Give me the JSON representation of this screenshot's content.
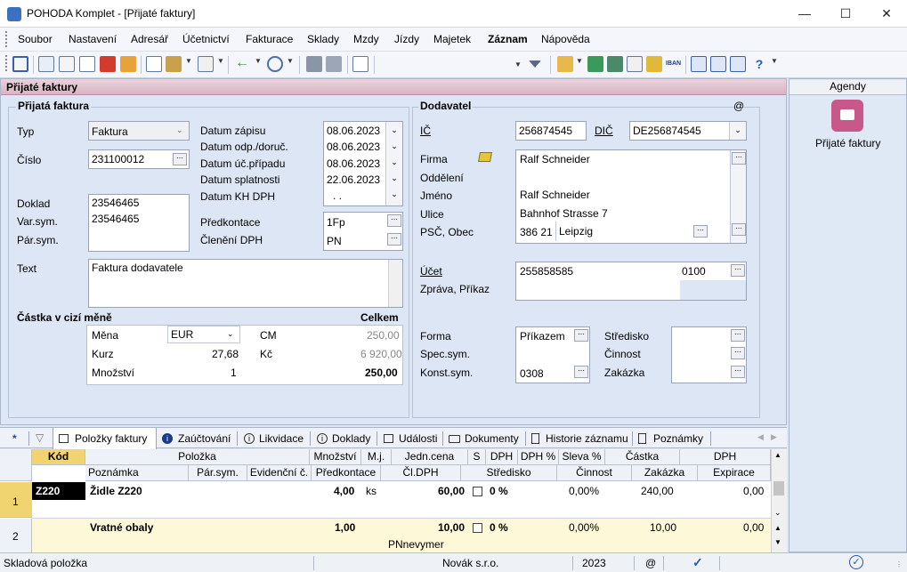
{
  "window": {
    "title": "POHODA Komplet - [Přijaté faktury]"
  },
  "menu": [
    "Soubor",
    "Nastavení",
    "Adresář",
    "Účetnictví",
    "Fakturace",
    "Sklady",
    "Mzdy",
    "Jízdy",
    "Majetek",
    "Záznam",
    "Nápověda"
  ],
  "toolbar": {
    "search_value": "",
    "iban_label": "IBAN"
  },
  "agenda_header": "Přijaté faktury",
  "left": {
    "group_title": "Přijatá faktura",
    "typ_label": "Typ",
    "typ_value": "Faktura",
    "cislo_label": "Číslo",
    "cislo_value": "231100012",
    "doklad_label": "Doklad",
    "doklad_value": "23546465",
    "varsym_label": "Var.sym.",
    "varsym_value": "23546465",
    "parsym_label": "Pár.sym.",
    "datum_zapisu_label": "Datum zápisu",
    "datum_zapisu": "08.06.2023",
    "datum_odp_label": "Datum odp./doruč.",
    "datum_odp": "08.06.2023",
    "datum_uc_label": "Datum úč.případu",
    "datum_uc": "08.06.2023",
    "datum_spl_label": "Datum splatnosti",
    "datum_spl": "22.06.2023",
    "datum_kh_label": "Datum KH DPH",
    "datum_kh": ". .",
    "predkontace_label": "Předkontace",
    "predkontace": "1Fp",
    "cleneni_label": "Členění DPH",
    "cleneni": "PN",
    "text_label": "Text",
    "text_value": "Faktura dodavatele",
    "cizi_title": "Částka v cizí měně",
    "celkem": "Celkem",
    "mena_label": "Měna",
    "mena": "EUR",
    "kurz_label": "Kurz",
    "kurz": "27,68",
    "mnozstvi_label": "Množství",
    "mnozstvi": "1",
    "cm_label": "CM",
    "cm_value": "250,00",
    "kc_label": "Kč",
    "kc_value": "6 920,00",
    "total": "250,00"
  },
  "right": {
    "group_title": "Dodavatel",
    "at": "@",
    "ic_label": "IČ",
    "ic": "256874545",
    "dic_label": "DIČ",
    "dic": "DE256874545",
    "firma_label": "Firma",
    "firma": "Ralf Schneider",
    "oddeleni_label": "Oddělení",
    "jmeno_label": "Jméno",
    "jmeno": "Ralf Schneider",
    "ulice_label": "Ulice",
    "ulice": "Bahnhof Strasse 7",
    "psc_label": "PSČ, Obec",
    "psc": "386 21",
    "obec": "Leipzig",
    "ucet_label": "Účet",
    "ucet": "255858585",
    "kod_banky": "0100",
    "zprava_label": "Zpráva, Příkaz",
    "forma_label": "Forma",
    "forma": "Příkazem",
    "spec_label": "Spec.sym.",
    "konst_label": "Konst.sym.",
    "konst": "0308",
    "stredisko_label": "Středisko",
    "cinnost_label": "Činnost",
    "zakazka_label": "Zakázka"
  },
  "sidebar": {
    "title": "Agendy",
    "item": "Přijaté faktury",
    "accent": "#c8588a"
  },
  "tabs": [
    "*",
    "Položky faktury",
    "Zaúčtování",
    "Likvidace",
    "Doklady",
    "Události",
    "Dokumenty",
    "Historie záznamu",
    "Poznámky"
  ],
  "grid": {
    "h1": [
      "Kód",
      "Položka",
      "Množství",
      "M.j.",
      "Jedn.cena",
      "S",
      "DPH",
      "DPH %",
      "Sleva %",
      "Částka",
      "DPH"
    ],
    "h2": [
      "Poznámka",
      "Pár.sym.",
      "Evidenční č.",
      "Předkontace",
      "Čl.DPH",
      "Středisko",
      "Činnost",
      "Zakázka",
      "Expirace"
    ],
    "rows": [
      {
        "num": "1",
        "kod": "Z220",
        "polozka": "Židle Z220",
        "mnozstvi": "4,00",
        "mj": "ks",
        "cena": "60,00",
        "dph_pct": "0 %",
        "sleva": "0,00%",
        "castka": "240,00",
        "dph": "0,00",
        "sub": ""
      },
      {
        "num": "2",
        "kod": "",
        "polozka": "Vratné obaly",
        "mnozstvi": "1,00",
        "mj": "",
        "cena": "10,00",
        "dph_pct": "0 %",
        "sleva": "0,00%",
        "castka": "10,00",
        "dph": "0,00",
        "sub": "PNnevymer"
      }
    ]
  },
  "status": {
    "left": "Skladová položka",
    "firm": "Novák  s.r.o.",
    "year": "2023",
    "at": "@"
  }
}
